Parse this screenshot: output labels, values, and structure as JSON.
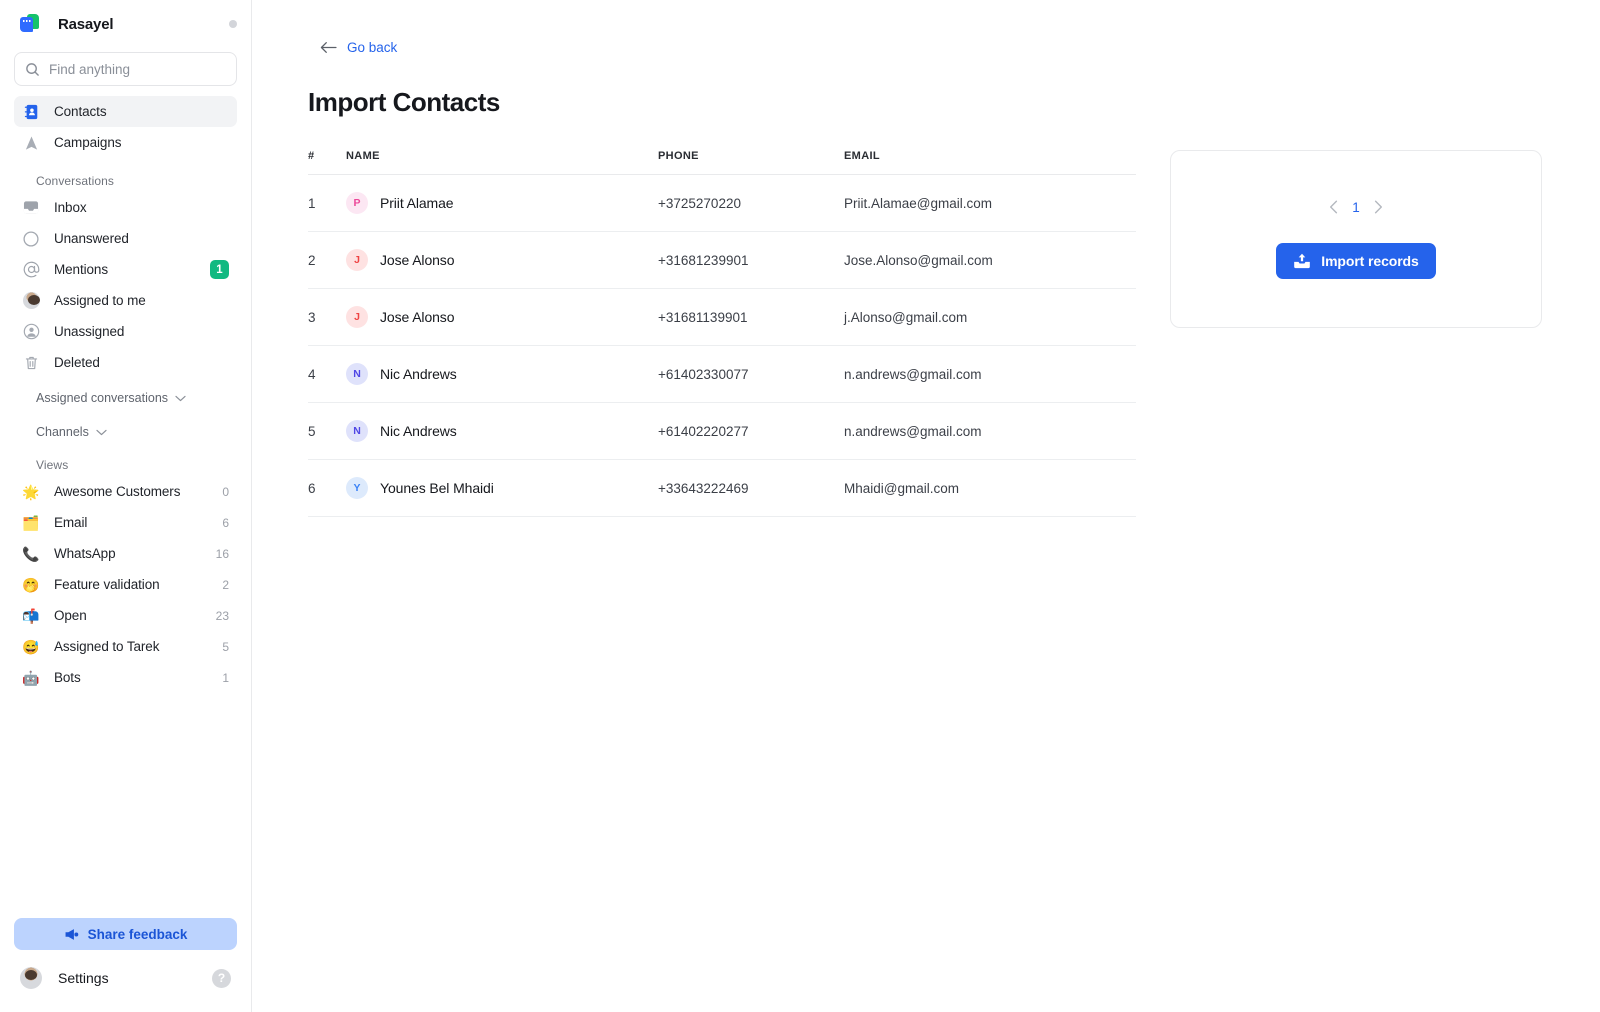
{
  "brand": {
    "name": "Rasayel",
    "logo_icon": "rasayel-logo-icon",
    "status_icon": "status-dot-icon"
  },
  "search": {
    "placeholder": "Find anything",
    "value": "",
    "icon": "search-icon"
  },
  "sidebar": {
    "primary": [
      {
        "label": "Contacts",
        "icon": "address-book-icon",
        "active": true
      },
      {
        "label": "Campaigns",
        "icon": "paper-plane-icon",
        "active": false
      }
    ],
    "conversations_title": "Conversations",
    "conversations": [
      {
        "label": "Inbox",
        "icon": "inbox-icon",
        "badge": ""
      },
      {
        "label": "Unanswered",
        "icon": "circle-icon",
        "badge": ""
      },
      {
        "label": "Mentions",
        "icon": "at-sign-icon",
        "badge": "1"
      },
      {
        "label": "Assigned to me",
        "icon": "user-avatar-icon",
        "badge": ""
      },
      {
        "label": "Unassigned",
        "icon": "user-circle-icon",
        "badge": ""
      },
      {
        "label": "Deleted",
        "icon": "trash-icon",
        "badge": ""
      }
    ],
    "groups": [
      {
        "label": "Assigned conversations",
        "icon": "chevron-down-icon"
      },
      {
        "label": "Channels",
        "icon": "chevron-down-icon"
      }
    ],
    "views_title": "Views",
    "views": [
      {
        "label": "Awesome Customers",
        "emoji": "🌟",
        "count": "0"
      },
      {
        "label": "Email",
        "emoji": "🗂️",
        "count": "6"
      },
      {
        "label": "WhatsApp",
        "emoji": "📞",
        "count": "16"
      },
      {
        "label": "Feature validation",
        "emoji": "🤭",
        "count": "2"
      },
      {
        "label": "Open",
        "emoji": "📬",
        "count": "23"
      },
      {
        "label": "Assigned to Tarek",
        "emoji": "😅",
        "count": "5"
      },
      {
        "label": "Bots",
        "emoji": "🤖",
        "count": "1"
      }
    ],
    "feedback_label": "Share feedback",
    "feedback_icon": "megaphone-icon",
    "settings_label": "Settings",
    "settings_avatar_icon": "user-avatar-icon",
    "help_label": "?"
  },
  "main": {
    "go_back_label": "Go back",
    "go_back_icon": "arrow-left-icon",
    "page_title": "Import Contacts",
    "table": {
      "headers": {
        "index": "#",
        "name": "NAME",
        "phone": "PHONE",
        "email": "EMAIL"
      },
      "rows": [
        {
          "index": "1",
          "initial": "P",
          "name": "Priit Alamae",
          "phone": "+3725270220",
          "email": "Priit.Alamae@gmail.com",
          "avatar_bg": "#fce7f3",
          "avatar_fg": "#ec4899"
        },
        {
          "index": "2",
          "initial": "J",
          "name": "Jose Alonso",
          "phone": "+31681239901",
          "email": "Jose.Alonso@gmail.com",
          "avatar_bg": "#fee2e2",
          "avatar_fg": "#ef4444"
        },
        {
          "index": "3",
          "initial": "J",
          "name": "Jose Alonso",
          "phone": "+31681139901",
          "email": "j.Alonso@gmail.com",
          "avatar_bg": "#fee2e2",
          "avatar_fg": "#ef4444"
        },
        {
          "index": "4",
          "initial": "N",
          "name": "Nic Andrews",
          "phone": "+61402330077",
          "email": "n.andrews@gmail.com",
          "avatar_bg": "#dfe2fb",
          "avatar_fg": "#4f46e5"
        },
        {
          "index": "5",
          "initial": "N",
          "name": "Nic Andrews",
          "phone": "+61402220277",
          "email": "n.andrews@gmail.com",
          "avatar_bg": "#dfe2fb",
          "avatar_fg": "#4f46e5"
        },
        {
          "index": "6",
          "initial": "Y",
          "name": "Younes Bel Mhaidi",
          "phone": "+33643222469",
          "email": "Mhaidi@gmail.com",
          "avatar_bg": "#ddeafc",
          "avatar_fg": "#3b82f6"
        }
      ]
    },
    "panel": {
      "page_number": "1",
      "prev_icon": "chevron-left-icon",
      "next_icon": "chevron-right-icon",
      "import_label": "Import records",
      "import_icon": "upload-icon"
    }
  },
  "colors": {
    "accent_blue": "#2563eb",
    "badge_green": "#12b981",
    "feedback_bg": "#bcd3fe",
    "border": "#e9eaec"
  }
}
